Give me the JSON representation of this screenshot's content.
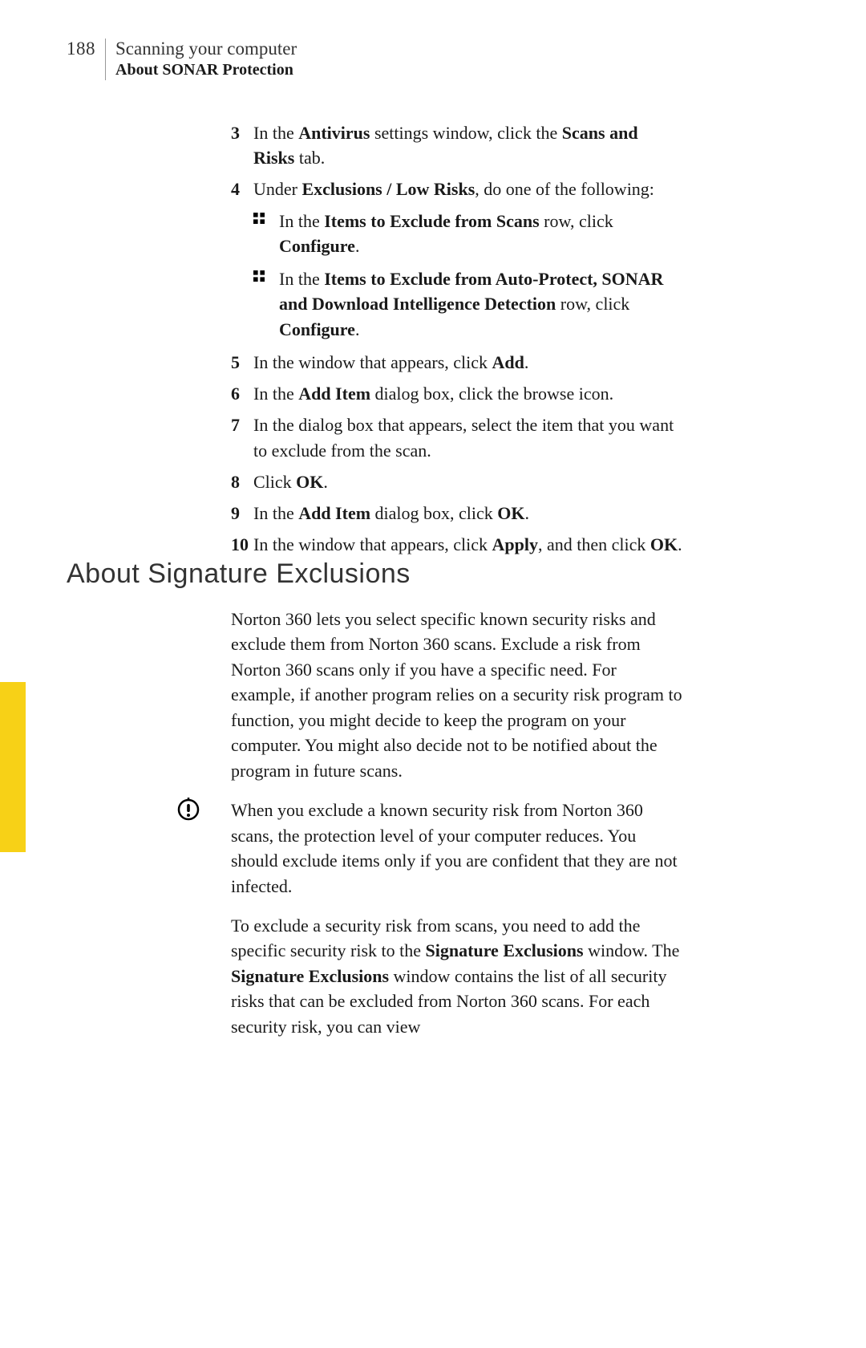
{
  "header": {
    "page_number": "188",
    "chapter": "Scanning your computer",
    "section": "About SONAR Protection"
  },
  "steps": [
    {
      "num": "3",
      "parts": [
        {
          "t": "In the ",
          "b": false
        },
        {
          "t": "Antivirus",
          "b": true
        },
        {
          "t": " settings window, click the ",
          "b": false
        },
        {
          "t": "Scans and Risks",
          "b": true
        },
        {
          "t": " tab.",
          "b": false
        }
      ]
    },
    {
      "num": "4",
      "parts": [
        {
          "t": "Under ",
          "b": false
        },
        {
          "t": "Exclusions / Low Risks",
          "b": true
        },
        {
          "t": ", do one of the following:",
          "b": false
        }
      ],
      "bullets": [
        [
          {
            "t": "In the ",
            "b": false
          },
          {
            "t": "Items to Exclude from Scans",
            "b": true
          },
          {
            "t": " row, click ",
            "b": false
          },
          {
            "t": "Configure",
            "b": true
          },
          {
            "t": ".",
            "b": false
          }
        ],
        [
          {
            "t": "In the ",
            "b": false
          },
          {
            "t": "Items to Exclude from Auto-Protect, SONAR and Download Intelligence Detection",
            "b": true
          },
          {
            "t": " row, click ",
            "b": false
          },
          {
            "t": "Configure",
            "b": true
          },
          {
            "t": ".",
            "b": false
          }
        ]
      ]
    },
    {
      "num": "5",
      "parts": [
        {
          "t": "In the window that appears, click ",
          "b": false
        },
        {
          "t": "Add",
          "b": true
        },
        {
          "t": ".",
          "b": false
        }
      ]
    },
    {
      "num": "6",
      "parts": [
        {
          "t": "In the ",
          "b": false
        },
        {
          "t": "Add Item",
          "b": true
        },
        {
          "t": " dialog box, click the browse icon.",
          "b": false
        }
      ]
    },
    {
      "num": "7",
      "parts": [
        {
          "t": "In the dialog box that appears, select the item that you want to exclude from the scan.",
          "b": false
        }
      ]
    },
    {
      "num": "8",
      "parts": [
        {
          "t": "Click ",
          "b": false
        },
        {
          "t": "OK",
          "b": true
        },
        {
          "t": ".",
          "b": false
        }
      ]
    },
    {
      "num": "9",
      "parts": [
        {
          "t": "In the ",
          "b": false
        },
        {
          "t": "Add Item",
          "b": true
        },
        {
          "t": " dialog box, click ",
          "b": false
        },
        {
          "t": "OK",
          "b": true
        },
        {
          "t": ".",
          "b": false
        }
      ]
    },
    {
      "num": "10",
      "parts": [
        {
          "t": "In the window that appears, click ",
          "b": false
        },
        {
          "t": "Apply",
          "b": true
        },
        {
          "t": ", and then click ",
          "b": false
        },
        {
          "t": "OK",
          "b": true
        },
        {
          "t": ".",
          "b": false
        }
      ]
    }
  ],
  "section_heading": "About Signature Exclusions",
  "paragraphs": [
    {
      "warning": false,
      "parts": [
        {
          "t": "Norton 360 lets you select specific known security risks and exclude them from Norton 360 scans. Exclude a risk from Norton 360 scans only if you have a specific need. For example, if another program relies on a security risk program to function, you might decide to keep the program on your computer. You might also decide not to be notified about the program in future scans.",
          "b": false
        }
      ]
    },
    {
      "warning": true,
      "parts": [
        {
          "t": "When you exclude a known security risk from Norton 360 scans, the protection level of your computer reduces. You should exclude items only if you are confident that they are not infected.",
          "b": false
        }
      ]
    },
    {
      "warning": false,
      "parts": [
        {
          "t": "To exclude a security risk from scans, you need to add the specific security risk to the ",
          "b": false
        },
        {
          "t": "Signature Exclusions",
          "b": true
        },
        {
          "t": " window. The ",
          "b": false
        },
        {
          "t": "Signature Exclusions",
          "b": true
        },
        {
          "t": " window contains the list of all security risks that can be excluded from Norton 360 scans. For each security risk, you can view",
          "b": false
        }
      ]
    }
  ]
}
